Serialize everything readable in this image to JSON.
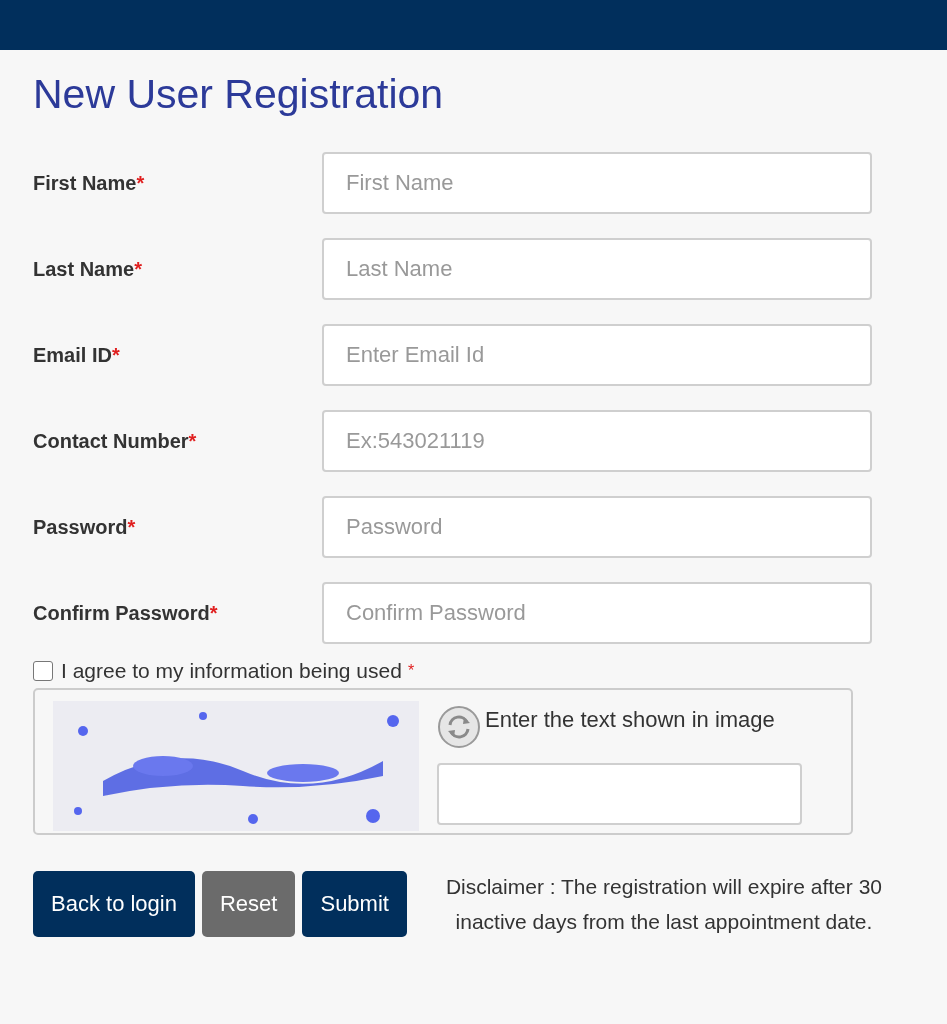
{
  "title": "New User Registration",
  "fields": [
    {
      "label": "First Name",
      "required_mark": "*",
      "placeholder": "First Name"
    },
    {
      "label": "Last Name",
      "required_mark": "*",
      "placeholder": "Last Name"
    },
    {
      "label": "Email ID",
      "required_mark": "*",
      "placeholder": "Enter Email Id"
    },
    {
      "label": "Contact Number",
      "required_mark": "*",
      "placeholder": "Ex:543021119"
    },
    {
      "label": "Password",
      "required_mark": "*",
      "placeholder": "Password"
    },
    {
      "label": "Confirm Password",
      "required_mark": "*",
      "placeholder": "Confirm Password"
    }
  ],
  "agree": {
    "label": "I agree to my information being used",
    "required_mark": "*",
    "checked": false
  },
  "captcha": {
    "prompt": "Enter the text shown in image"
  },
  "buttons": [
    {
      "label": "Back to login",
      "kind": "primary"
    },
    {
      "label": "Reset",
      "kind": "secondary"
    },
    {
      "label": "Submit",
      "kind": "primary"
    }
  ],
  "disclaimer": "Disclaimer : The registration will expire after 30 inactive days from the last appointment date."
}
